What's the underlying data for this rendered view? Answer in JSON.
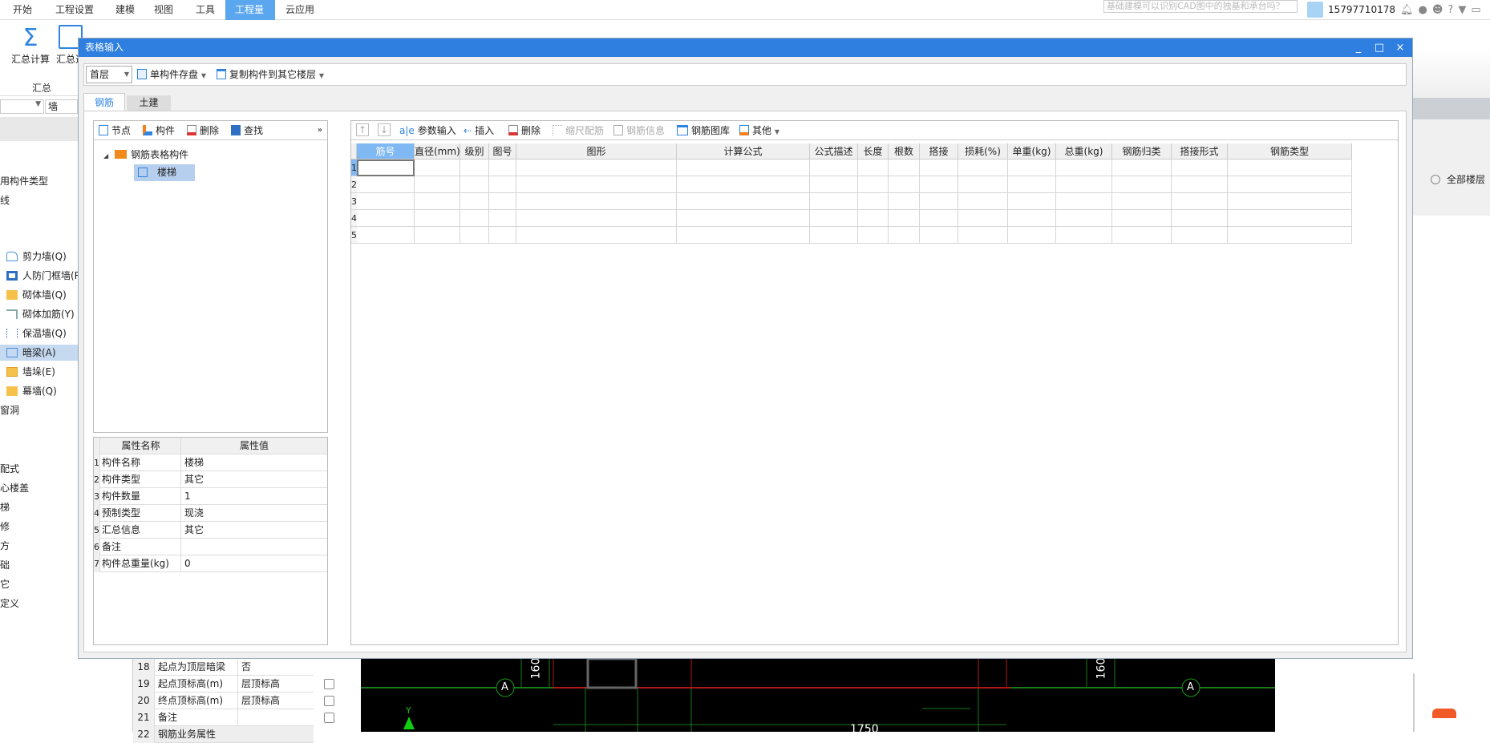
{
  "menubar": {
    "items": [
      "开始",
      "工程设置",
      "建模",
      "视图",
      "工具",
      "工程量",
      "云应用"
    ],
    "active": "工程量",
    "search_placeholder": "基础建模可以识别CAD图中的独基和承台吗？",
    "user": "15797710178"
  },
  "ribbon": {
    "sum_calc": "汇总计算",
    "sum_select": "汇总选",
    "group_label": "汇总",
    "accent": "#2e84df"
  },
  "left_app": {
    "combo_value": "",
    "wall_field": "墙",
    "items": [
      {
        "label": "用构件类型"
      },
      {
        "label": "线"
      },
      {
        "label": "剪力墙(Q)",
        "icon": "shear-wall-icon"
      },
      {
        "label": "人防门框墙(R",
        "icon": "civil-defense-wall-icon"
      },
      {
        "label": "砌体墙(Q)",
        "icon": "masonry-wall-icon"
      },
      {
        "label": "砌体加筋(Y)",
        "icon": "masonry-rebar-icon"
      },
      {
        "label": "保温墙(Q)",
        "icon": "insulation-wall-icon"
      },
      {
        "label": "暗梁(A)",
        "icon": "hidden-beam-icon",
        "selected": true
      },
      {
        "label": "墙垛(E)",
        "icon": "wall-pier-icon"
      },
      {
        "label": "幕墙(Q)",
        "icon": "curtain-wall-icon"
      },
      {
        "label": "窗洞"
      },
      {
        "label": "配式"
      },
      {
        "label": "心楼盖"
      },
      {
        "label": "梯"
      },
      {
        "label": "修"
      },
      {
        "label": "方"
      },
      {
        "label": "础"
      },
      {
        "label": "它"
      },
      {
        "label": "定义"
      }
    ]
  },
  "right_app": {
    "all_floors": "全部楼层"
  },
  "bg_props": {
    "rows": [
      {
        "n": "18",
        "k": "起点为顶层暗梁",
        "v": "否",
        "check": false
      },
      {
        "n": "19",
        "k": "起点顶标高(m)",
        "v": "层顶标高",
        "check": true
      },
      {
        "n": "20",
        "k": "终点顶标高(m)",
        "v": "层顶标高",
        "check": true
      },
      {
        "n": "21",
        "k": "备注",
        "v": "",
        "check": true
      },
      {
        "n": "22",
        "k": "钢筋业务属性",
        "v": "",
        "check": false
      }
    ]
  },
  "cad": {
    "axis_label": "A",
    "dim_left": "160",
    "dim_right": "160",
    "dim_bottom": "1750",
    "y_axis": "Y"
  },
  "dialog": {
    "title": "表格输入",
    "minimize": "_",
    "maximize": "□",
    "close": "×",
    "floor_value": "首层",
    "save_single": "单构件存盘",
    "copy_to_floors": "复制构件到其它楼层",
    "tabs": [
      "钢筋",
      "土建"
    ],
    "active_tab": "钢筋",
    "tree_toolbar": {
      "node": "节点",
      "component": "构件",
      "delete": "删除",
      "find": "查找",
      "more": "»"
    },
    "tree": {
      "root": "钢筋表格构件",
      "child": "楼梯"
    },
    "props": {
      "header": [
        "属性名称",
        "属性值"
      ],
      "rows": [
        {
          "n": "1",
          "k": "构件名称",
          "v": "楼梯"
        },
        {
          "n": "2",
          "k": "构件类型",
          "v": "其它"
        },
        {
          "n": "3",
          "k": "构件数量",
          "v": "1"
        },
        {
          "n": "4",
          "k": "预制类型",
          "v": "现浇"
        },
        {
          "n": "5",
          "k": "汇总信息",
          "v": "其它"
        },
        {
          "n": "6",
          "k": "备注",
          "v": ""
        },
        {
          "n": "7",
          "k": "构件总重量(kg)",
          "v": "0"
        }
      ]
    },
    "grid_toolbar": {
      "move_up": "↑",
      "move_down": "↓",
      "param_input": "参数输入",
      "insert": "插入",
      "delete": "删除",
      "scale_rebar": "缩尺配筋",
      "rebar_info": "钢筋信息",
      "rebar_library": "钢筋图库",
      "other": "其他"
    },
    "grid": {
      "columns": [
        "筋号",
        "直径(mm)",
        "级别",
        "图号",
        "图形",
        "计算公式",
        "公式描述",
        "长度",
        "根数",
        "搭接",
        "损耗(%)",
        "单重(kg)",
        "总重(kg)",
        "钢筋归类",
        "搭接形式",
        "钢筋类型"
      ],
      "rows": [
        "1",
        "2",
        "3",
        "4",
        "5"
      ]
    }
  }
}
